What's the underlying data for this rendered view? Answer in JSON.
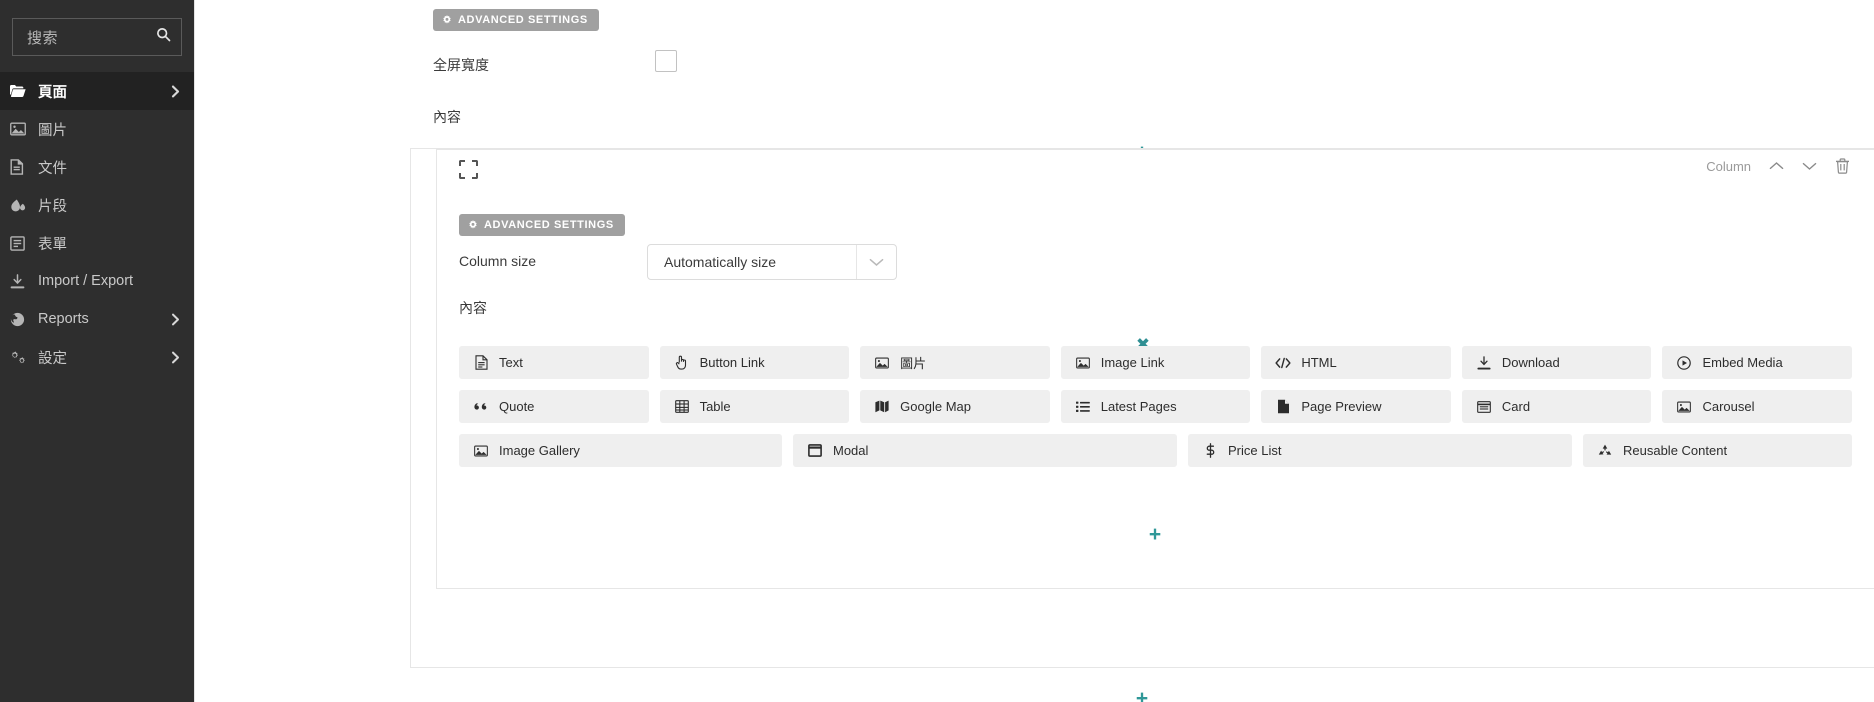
{
  "colors": {
    "teal": "#2f9898",
    "sidebar_bg": "#2e2e2e",
    "sidebar_active_bg": "#222222",
    "tile_bg": "#efefef",
    "adv_btn_bg": "#a0a0a0"
  },
  "sidebar": {
    "search": {
      "placeholder": "搜索",
      "value": "",
      "icon": "search-icon"
    },
    "items": [
      {
        "label": "頁面",
        "icon": "folder-open-icon",
        "active": true,
        "chevron": true
      },
      {
        "label": "圖片",
        "icon": "image-icon",
        "active": false,
        "chevron": false
      },
      {
        "label": "文件",
        "icon": "file-icon",
        "active": false,
        "chevron": false
      },
      {
        "label": "片段",
        "icon": "droplet-icon",
        "active": false,
        "chevron": false
      },
      {
        "label": "表單",
        "icon": "form-icon",
        "active": false,
        "chevron": false
      },
      {
        "label": "Import / Export",
        "icon": "download-icon",
        "active": false,
        "chevron": false
      },
      {
        "label": "Reports",
        "icon": "globe-icon",
        "active": false,
        "chevron": true
      },
      {
        "label": "設定",
        "icon": "cogs-icon",
        "active": false,
        "chevron": true
      }
    ]
  },
  "page": {
    "advanced_settings_label": "ADVANCED SETTINGS",
    "fullwidth_label": "全屏寬度",
    "fullwidth_checked": false,
    "content_label": "內容",
    "add_icon": "+",
    "remove_icon": "✖"
  },
  "column": {
    "advanced_settings_label": "ADVANCED SETTINGS",
    "type_label": "Column",
    "size_label": "Column size",
    "size_value": "Automatically size",
    "content_label": "內容",
    "move_up_icon": "chevron-up-icon",
    "move_down_icon": "chevron-down-icon",
    "delete_icon": "trash-icon"
  },
  "content_tiles": {
    "row1": [
      {
        "label": "Text",
        "icon": "document-icon"
      },
      {
        "label": "Button Link",
        "icon": "pointer-hand-icon"
      },
      {
        "label": "圖片",
        "icon": "image-icon"
      },
      {
        "label": "Image Link",
        "icon": "image-icon"
      },
      {
        "label": "HTML",
        "icon": "code-icon"
      },
      {
        "label": "Download",
        "icon": "download-icon"
      },
      {
        "label": "Embed Media",
        "icon": "play-circle-icon"
      }
    ],
    "row2": [
      {
        "label": "Quote",
        "icon": "quote-icon"
      },
      {
        "label": "Table",
        "icon": "table-icon"
      },
      {
        "label": "Google Map",
        "icon": "map-icon"
      },
      {
        "label": "Latest Pages",
        "icon": "list-icon"
      },
      {
        "label": "Page Preview",
        "icon": "page-icon"
      },
      {
        "label": "Card",
        "icon": "card-icon"
      },
      {
        "label": "Carousel",
        "icon": "image-icon"
      }
    ],
    "row3": [
      {
        "label": "Image Gallery",
        "icon": "image-icon"
      },
      {
        "label": "Modal",
        "icon": "window-icon"
      },
      {
        "label": "Price List",
        "icon": "dollar-icon"
      },
      {
        "label": "Reusable Content",
        "icon": "recycle-icon"
      }
    ]
  }
}
